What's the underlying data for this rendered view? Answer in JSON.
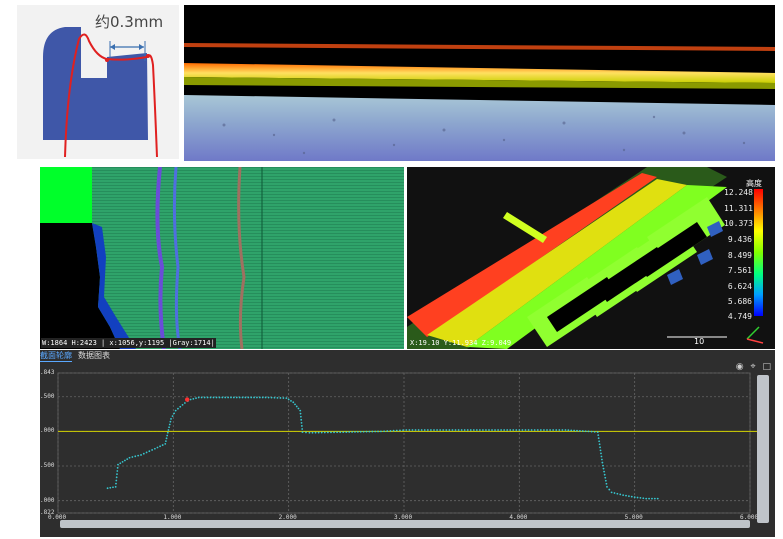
{
  "diagram": {
    "label": "约0.3mm"
  },
  "heightmap": {
    "status_text": "W:1864 H:2423 | x:1056,y:1195 |Gray:1714|"
  },
  "view3d": {
    "legend_title": "高度",
    "legend_values": [
      "12.248",
      "11.311",
      "10.373",
      "9.436",
      "8.499",
      "7.561",
      "6.624",
      "5.686",
      "4.749"
    ],
    "coords_text": "X:19.10 Y:11.934 Z:9.049",
    "scale_label": "10"
  },
  "profile": {
    "tabs": [
      "截面轮廓",
      "数据图表"
    ],
    "tool_icons": [
      "eye-icon",
      "crop-icon",
      "expand-icon"
    ],
    "colors": {
      "curve": "#36c6cf",
      "reference": "#d4d400",
      "marker": "#ff3030",
      "background": "#2e2e2e"
    },
    "reference_value": 9.0,
    "marker_point": {
      "x": 1.12,
      "y": 9.46
    }
  },
  "chart_data": {
    "type": "line",
    "title": "",
    "xlabel": "",
    "ylabel": "",
    "xlim": [
      0.0,
      6.0
    ],
    "ylim": [
      7.822,
      9.843
    ],
    "x_ticks": [
      "0.000",
      "1.000",
      "2.000",
      "3.000",
      "4.000",
      "5.000",
      "6.000"
    ],
    "y_ticks": [
      ".843",
      ".500",
      ".000",
      ".500",
      ".000",
      ".822"
    ],
    "grid": true,
    "series": [
      {
        "x": [
          0.43,
          0.5,
          0.52,
          0.56,
          0.62,
          0.72,
          0.84,
          0.93,
          0.98,
          1.02,
          1.1,
          1.15,
          1.22,
          1.4,
          1.6,
          1.8,
          1.98,
          2.04,
          2.1,
          2.12,
          2.18,
          2.5,
          2.8,
          3.02,
          3.5,
          4.0,
          4.4,
          4.6,
          4.68,
          4.72,
          4.76,
          4.8,
          4.9,
          5.0,
          5.1,
          5.2
        ],
        "y": [
          8.18,
          8.2,
          8.52,
          8.56,
          8.62,
          8.66,
          8.75,
          8.82,
          9.18,
          9.3,
          9.41,
          9.46,
          9.49,
          9.49,
          9.49,
          9.49,
          9.48,
          9.42,
          9.3,
          8.99,
          8.98,
          8.99,
          9.0,
          9.02,
          9.02,
          9.02,
          9.02,
          9.0,
          8.99,
          8.55,
          8.2,
          8.12,
          8.08,
          8.05,
          8.03,
          8.03
        ]
      }
    ]
  }
}
